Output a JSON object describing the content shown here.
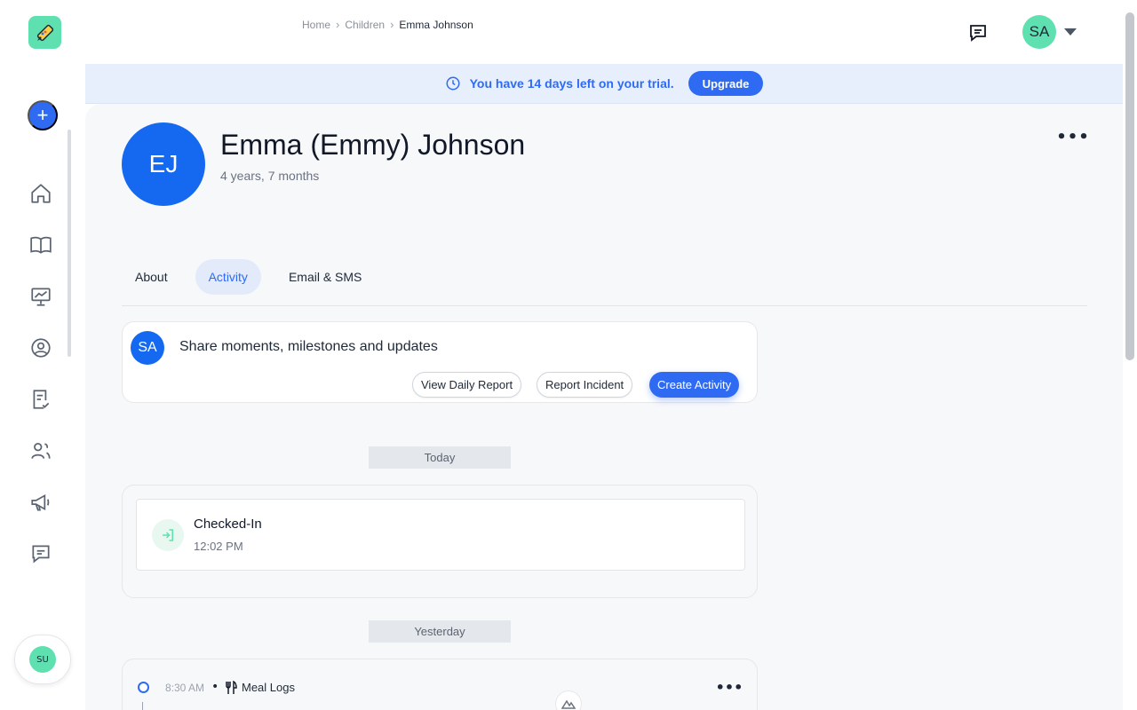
{
  "breadcrumb": {
    "items": [
      "Home",
      "Children"
    ],
    "current": "Emma Johnson"
  },
  "user": {
    "initials": "SA"
  },
  "trial": {
    "text": "You have 14 days left on your trial.",
    "button": "Upgrade"
  },
  "profile": {
    "initials": "EJ",
    "name": "Emma (Emmy) Johnson",
    "age": "4 years, 7 months"
  },
  "tabs": [
    {
      "label": "About",
      "active": false
    },
    {
      "label": "Activity",
      "active": true
    },
    {
      "label": "Email & SMS",
      "active": false
    }
  ],
  "composer": {
    "initials": "SA",
    "placeholder": "Share moments, milestones and updates",
    "buttons": {
      "daily_report": "View Daily Report",
      "incident": "Report Incident",
      "create": "Create Activity"
    }
  },
  "timeline": {
    "today_label": "Today",
    "checkin": {
      "title": "Checked-In",
      "time": "12:02 PM"
    },
    "yesterday_label": "Yesterday",
    "meal": {
      "time": "8:30 AM",
      "bullet": "•",
      "title": "Meal Logs"
    }
  },
  "sidebar": {
    "bottom_user": "SU",
    "icons": [
      "home-icon",
      "book-icon",
      "presentation-icon",
      "user-circle-icon",
      "checklist-icon",
      "users-icon",
      "megaphone-icon",
      "message-icon"
    ]
  },
  "colors": {
    "primary": "#2f6bf2",
    "avatar_blue": "#1469f0",
    "accent_green": "#5ee0b0",
    "banner_bg": "#e8effc"
  }
}
